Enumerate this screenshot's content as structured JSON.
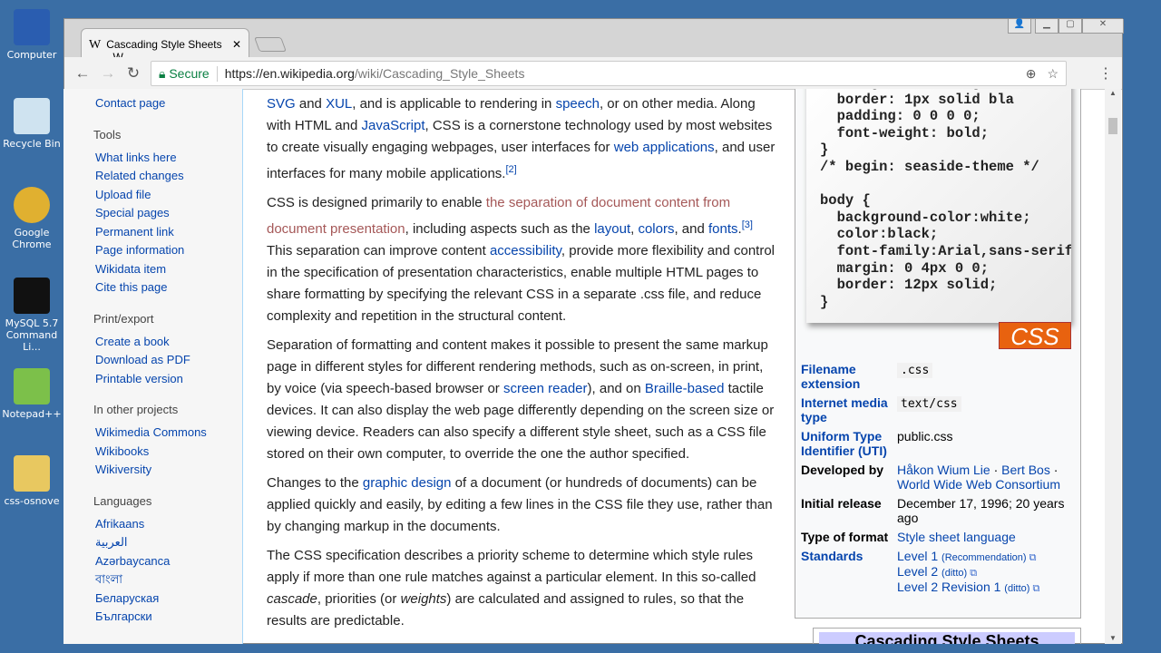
{
  "desktop": [
    {
      "label": "Computer"
    },
    {
      "label": "Recycle Bin"
    },
    {
      "label": "Google Chrome"
    },
    {
      "label": "MySQL 5.7 Command Li..."
    },
    {
      "label": "Notepad++"
    },
    {
      "label": "css-osnove"
    }
  ],
  "browser": {
    "tab_title": "Cascading Style Sheets - W",
    "tab_icon": "W",
    "secure": "Secure",
    "url_host": "https://en.wikipedia.org",
    "url_path": "/wiki/Cascading_Style_Sheets"
  },
  "sidebar": {
    "top_link": "Contact page",
    "sections": [
      {
        "title": "Tools",
        "items": [
          "What links here",
          "Related changes",
          "Upload file",
          "Special pages",
          "Permanent link",
          "Page information",
          "Wikidata item",
          "Cite this page"
        ]
      },
      {
        "title": "Print/export",
        "items": [
          "Create a book",
          "Download as PDF",
          "Printable version"
        ]
      },
      {
        "title": "In other projects",
        "items": [
          "Wikimedia Commons",
          "Wikibooks",
          "Wikiversity"
        ]
      },
      {
        "title": "Languages",
        "items": [
          "Afrikaans",
          "العربية",
          "Azərbaycanca",
          "বাংলা",
          "Беларуская",
          "Български"
        ]
      }
    ]
  },
  "article": {
    "paragraphs": [
      [
        {
          "t": "SVG",
          "l": 1
        },
        {
          "t": " and "
        },
        {
          "t": "XUL",
          "l": 1
        },
        {
          "t": ", and is applicable to rendering in "
        },
        {
          "t": "speech",
          "l": 1
        },
        {
          "t": ", or on other media. Along with HTML and "
        },
        {
          "t": "JavaScript",
          "l": 1
        },
        {
          "t": ", CSS is a cornerstone technology used by most websites to create visually engaging webpages, user interfaces for "
        },
        {
          "t": "web applications",
          "l": 1
        },
        {
          "t": ", and user interfaces for many mobile applications."
        },
        {
          "t": "[2]",
          "s": 1
        }
      ],
      [
        {
          "t": "CSS is designed primarily to enable "
        },
        {
          "t": "the separation of document content from document presentation",
          "l": 2
        },
        {
          "t": ", including aspects such as the "
        },
        {
          "t": "layout",
          "l": 1
        },
        {
          "t": ", "
        },
        {
          "t": "colors",
          "l": 1
        },
        {
          "t": ", and "
        },
        {
          "t": "fonts",
          "l": 1
        },
        {
          "t": ".",
          "x": 1
        },
        {
          "t": "[3]",
          "s": 1
        },
        {
          "t": " This separation can improve content "
        },
        {
          "t": "accessibility",
          "l": 1
        },
        {
          "t": ", provide more flexibility and control in the specification of presentation characteristics, enable multiple HTML pages to share formatting by specifying the relevant CSS in a separate .css file, and reduce complexity and repetition in the structural content."
        }
      ],
      [
        {
          "t": "Separation of formatting and content makes it possible to present the same markup page in different styles for different rendering methods, such as on-screen, in print, by voice (via speech-based browser or "
        },
        {
          "t": "screen reader",
          "l": 1
        },
        {
          "t": "), and on "
        },
        {
          "t": "Braille-based",
          "l": 1
        },
        {
          "t": " tactile devices. It can also display the web page differently depending on the screen size or viewing device. Readers can also specify a different style sheet, such as a CSS file stored on their own computer, to override the one the author specified."
        }
      ],
      [
        {
          "t": "Changes to the "
        },
        {
          "t": "graphic design",
          "l": 1
        },
        {
          "t": " of a document (or hundreds of documents) can be applied quickly and easily, by editing a few lines in the CSS file they use, rather than by changing markup in the documents."
        }
      ],
      [
        {
          "t": "The CSS specification describes a priority scheme to determine which style rules apply if more than one rule matches against a particular element. In this so-called "
        },
        {
          "t": "cascade",
          "i": 1
        },
        {
          "t": ", priorities (or "
        },
        {
          "t": "weights",
          "i": 1
        },
        {
          "t": ") are calculated and assigned to rules, so that the results are predictable."
        }
      ]
    ]
  },
  "infobox": {
    "code": "  background: orange;\n  border: 1px solid bla\n  padding: 0 0 0 0;\n  font-weight: bold;\n}\n/* begin: seaside-theme */\n\nbody {\n  background-color:white;\n  color:black;\n  font-family:Arial,sans-serif;\n  margin: 0 4px 0 0;\n  border: 12px solid;\n}",
    "logo": "CSS",
    "filename_label": "Filename extension",
    "filename": ".css",
    "media_label": "Internet media type",
    "media": "text/css",
    "uti_label": "Uniform Type Identifier (UTI)",
    "uti": "public.css",
    "dev_label": "Developed by",
    "dev1": "Håkon Wium Lie",
    "dev2": "Bert Bos",
    "dev3": "World Wide Web Consortium",
    "sep": " · ",
    "release_label": "Initial release",
    "release": "December 17, 1996; 20 years ago",
    "type_label": "Type of format",
    "type": "Style sheet language",
    "standards_label": "Standards",
    "standards": [
      {
        "name": "Level 1",
        "note": "(Recommendation)"
      },
      {
        "name": "Level 2",
        "note": "(ditto)"
      },
      {
        "name": "Level 2 Revision 1",
        "note": "(ditto)"
      }
    ],
    "navbox_title": "Cascading Style Sheets"
  }
}
